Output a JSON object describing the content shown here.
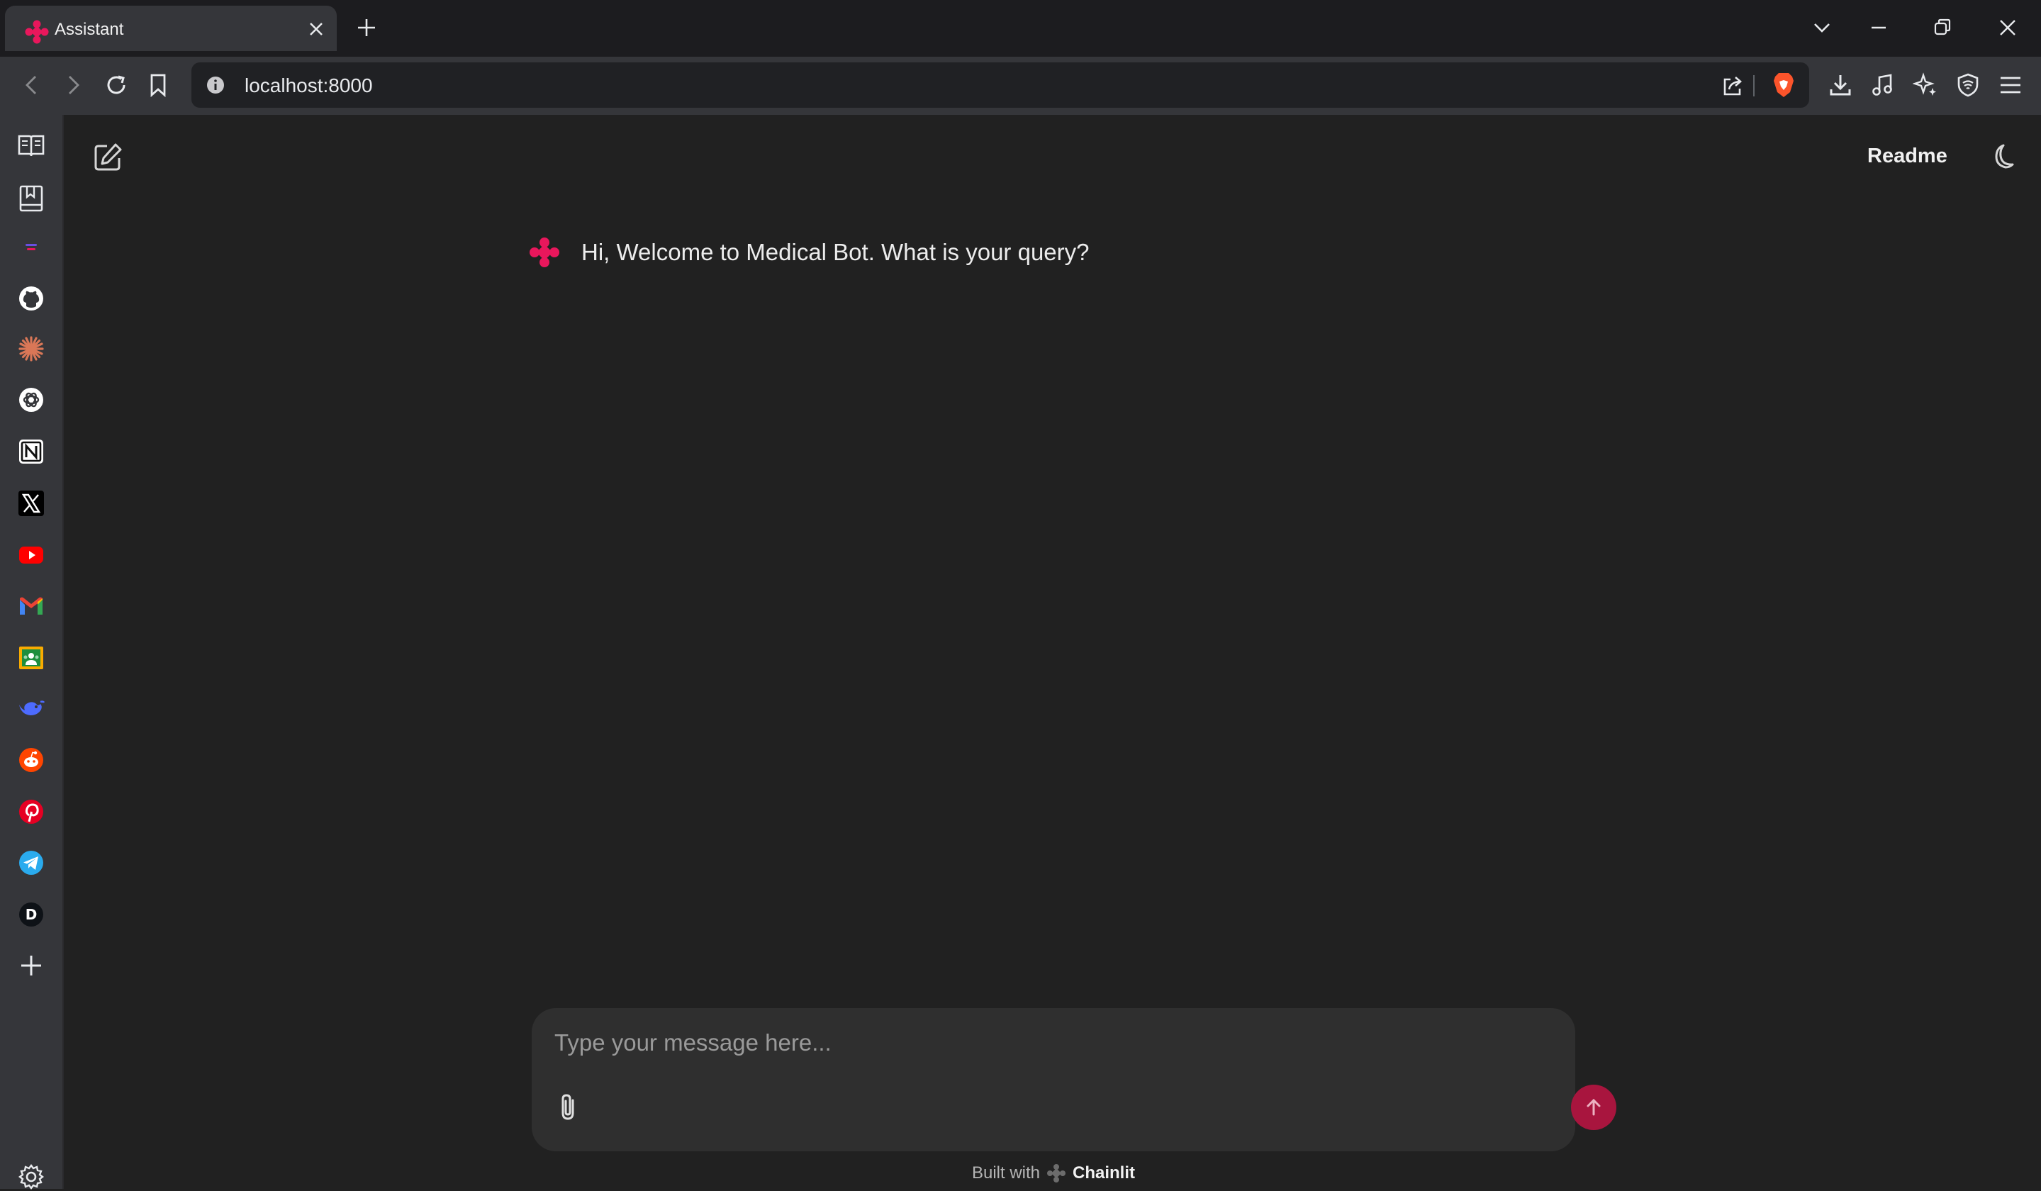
{
  "browser": {
    "tab_title": "Assistant",
    "url": "localhost:8000"
  },
  "app": {
    "header": {
      "readme_label": "Readme"
    },
    "welcome_message": "Hi, Welcome to Medical Bot. What is your query?",
    "composer": {
      "placeholder": "Type your message here..."
    },
    "footer": {
      "built_with": "Built with",
      "brand": "Chainlit"
    }
  },
  "colors": {
    "accent": "#e9175c",
    "send_button": "#a8153e",
    "background": "#212121",
    "composer": "#2f2f2f"
  },
  "sidebar_icons": [
    "reading-list-icon",
    "bookmarks-icon",
    "leo-icon",
    "github-icon",
    "claude-icon",
    "chatgpt-icon",
    "notion-icon",
    "x-icon",
    "youtube-icon",
    "gmail-icon",
    "google-classroom-icon",
    "deepseek-icon",
    "reddit-icon",
    "pinterest-icon",
    "telegram-icon",
    "dailydev-icon",
    "add-icon",
    "settings-icon"
  ]
}
